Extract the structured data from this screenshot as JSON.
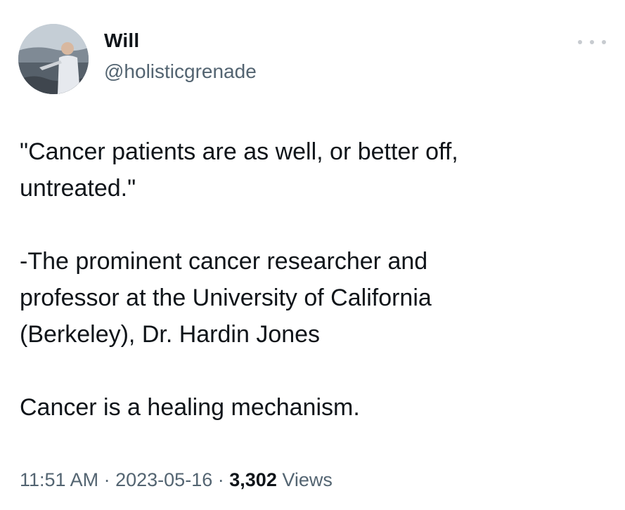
{
  "tweet": {
    "author": {
      "display_name": "Will",
      "handle": "@holisticgrenade",
      "avatar_icon": "profile-photo"
    },
    "more_icon": "more-options-icon",
    "lines": [
      "\"Cancer patients are as well, or better off,",
      "untreated.\"",
      "-The prominent cancer researcher and",
      "professor at the University of California",
      "(Berkeley), Dr. Hardin Jones",
      "Cancer is a healing mechanism."
    ],
    "meta": {
      "time": "11:51 AM",
      "separator": "·",
      "date": "2023-05-16",
      "views_count": "3,302",
      "views_label": "Views"
    }
  }
}
